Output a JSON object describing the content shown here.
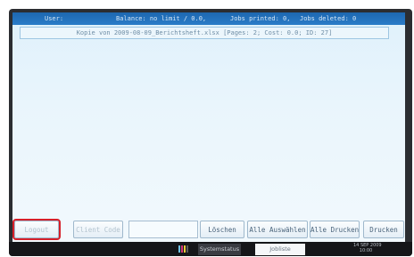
{
  "status_bar": {
    "user_label": "User:",
    "balance": "Balance: no limit / 0.0,",
    "jobs_printed": "Jobs printed: 0,",
    "jobs_deleted": "Jobs deleted: 0"
  },
  "jobs": [
    {
      "text": "Kopie von 2009-08-09_Berichtsheft.xlsx [Pages: 2; Cost: 0.0; ID: 27]"
    }
  ],
  "buttons": {
    "logout": "Logout",
    "client_code": "Client Code",
    "delete": "Löschen",
    "select_all": "Alle Auswählen",
    "print_all": "Alle Drucken",
    "print": "Drucken"
  },
  "taskbar": {
    "system_status": "Systemstatus",
    "job_list": "Jobliste",
    "date": "14 SEP  2009",
    "time": "10:00"
  },
  "colors": {
    "status_bar": "#1d67b0",
    "selection_outline": "#d6202a",
    "button_text": "#48627a"
  }
}
